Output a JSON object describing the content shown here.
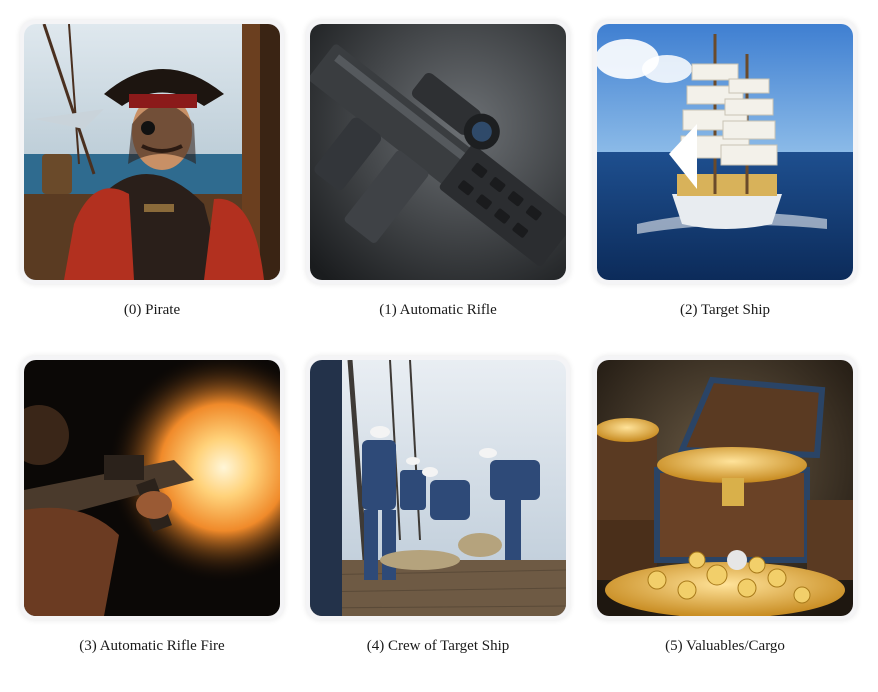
{
  "panels": [
    {
      "caption": "(0) Pirate"
    },
    {
      "caption": "(1) Automatic Rifle"
    },
    {
      "caption": "(2) Target Ship"
    },
    {
      "caption": "(3) Automatic Rifle Fire"
    },
    {
      "caption": "(4) Crew of Target Ship"
    },
    {
      "caption": "(5) Valuables/Cargo"
    }
  ]
}
